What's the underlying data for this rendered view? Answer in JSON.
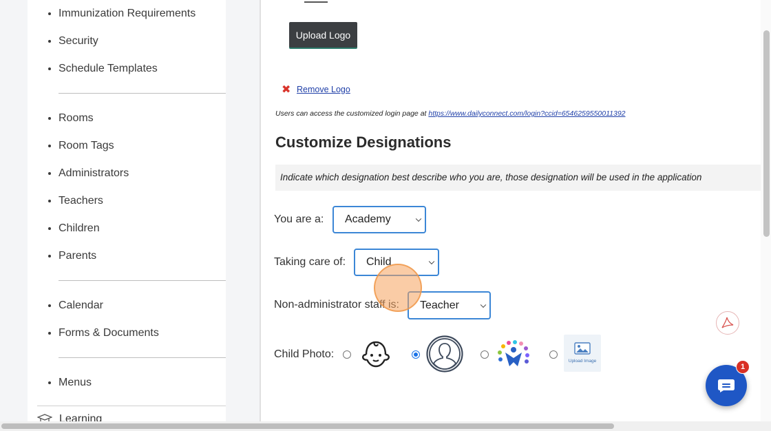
{
  "sidebar": {
    "group1": [
      "Immunization Requirements",
      "Security",
      "Schedule Templates"
    ],
    "group2": [
      "Rooms",
      "Room Tags",
      "Administrators",
      "Teachers",
      "Children",
      "Parents"
    ],
    "group3": [
      "Calendar",
      "Forms & Documents"
    ],
    "group4": [
      "Menus"
    ],
    "learning": "Learning"
  },
  "logo": {
    "upload_label": "Upload Logo",
    "remove_label": "Remove Logo"
  },
  "access_note": {
    "text": "Users can access the customized login page at ",
    "url": "https://www.dailyconnect.com/login?ccid=6546259550011392"
  },
  "designations": {
    "title": "Customize Designations",
    "info": "Indicate which designation best describe who you are, those designation will be used in the application",
    "you_are_label": "You are a:",
    "you_are_value": "Academy",
    "care_of_label": "Taking care of:",
    "care_of_value": "Child",
    "staff_label": "Non-administrator staff is:",
    "staff_value": "Teacher",
    "photo_label": "Child Photo:",
    "photo_selected": 1,
    "upload_image_label": "Upload Image"
  },
  "chat": {
    "badge_count": "1"
  },
  "colors": {
    "accent": "#3b86d6",
    "chat": "#1f57c5",
    "badge": "#d93025",
    "remove": "#d9342b"
  }
}
